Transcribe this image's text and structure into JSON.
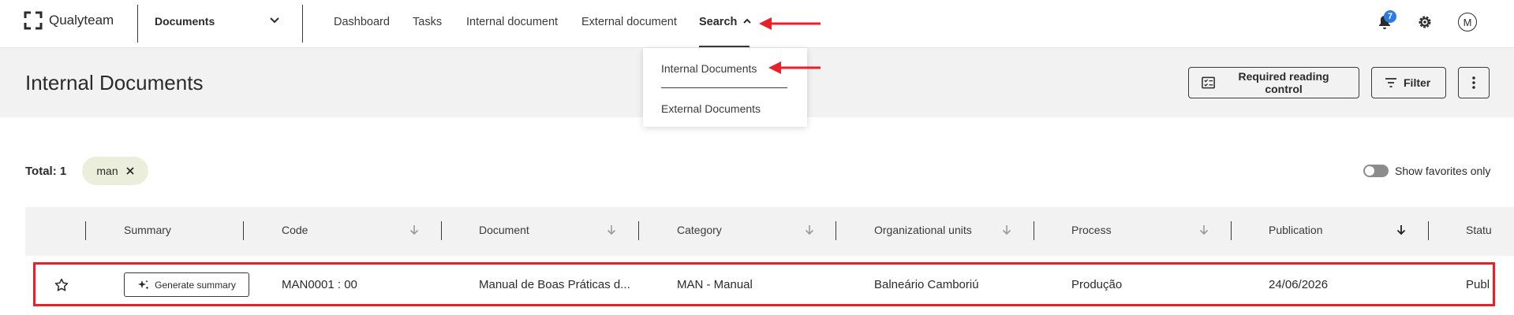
{
  "app": {
    "logo_text": "Qualyteam",
    "module_select": "Documents"
  },
  "nav": {
    "items": [
      "Dashboard",
      "Tasks",
      "Internal document",
      "External document"
    ],
    "search": "Search"
  },
  "notifications": {
    "count": "7"
  },
  "user": {
    "initial": "M"
  },
  "page": {
    "title": "Internal Documents",
    "required_reading": "Required reading control",
    "filter": "Filter"
  },
  "search_menu": {
    "items": [
      "Internal Documents",
      "External Documents"
    ]
  },
  "results": {
    "total": "Total: 1",
    "chip": "man",
    "favorites_label": "Show favorites only"
  },
  "table": {
    "headers": [
      "Summary",
      "Code",
      "Document",
      "Category",
      "Organizational units",
      "Process",
      "Publication",
      "Statu"
    ],
    "row": {
      "generate_summary": "Generate summary",
      "code": "MAN0001 : 00",
      "document": "Manual de Boas Práticas d...",
      "category": "MAN - Manual",
      "org_unit": "Balneário Camboriú",
      "process": "Produção",
      "publication": "24/06/2026",
      "status": "Publ"
    }
  },
  "colors": {
    "annotation_red": "#e8202a",
    "badge_blue": "#2c7be5",
    "chip_bg": "#ebeeda",
    "header_band": "#f2f2f2"
  }
}
